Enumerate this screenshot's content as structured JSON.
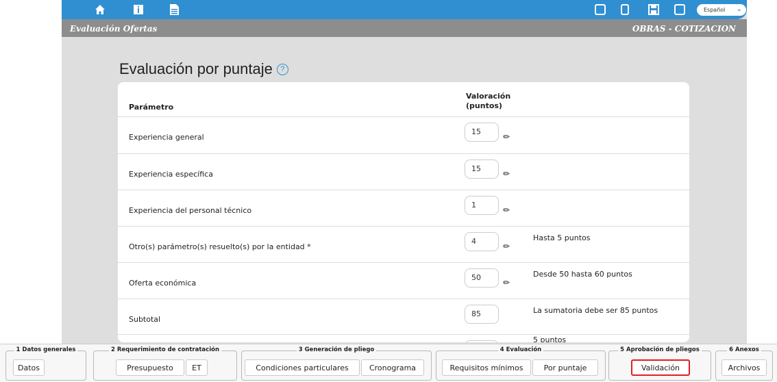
{
  "header": {
    "language": "Español",
    "section_left": "Evaluación Ofertas",
    "section_right": "OBRAS - COTIZACION"
  },
  "main": {
    "title": "Evaluación por puntaje",
    "help": "?",
    "col_param": "Parámetro",
    "col_val_1": "Valoración",
    "col_val_2": "(puntos)",
    "rows": [
      {
        "name": "Experiencia general",
        "value": "15",
        "note": ""
      },
      {
        "name": "Experiencia específica",
        "value": "15",
        "note": ""
      },
      {
        "name": "Experiencia del personal técnico",
        "value": "1",
        "note": ""
      },
      {
        "name": "Otro(s) parámetro(s) resuelto(s) por la entidad *",
        "value": "4",
        "note": "Hasta 5 puntos"
      },
      {
        "name": "Oferta económica",
        "value": "50",
        "note": "Desde 50 hasta 60 puntos"
      },
      {
        "name": "Subtotal",
        "value": "85",
        "note": "La sumatoria debe ser 85 puntos"
      },
      {
        "name": "",
        "value": "",
        "note": "5 puntos"
      }
    ]
  },
  "footer": {
    "groups": [
      {
        "label": "1 Datos generales",
        "buttons": [
          "Datos"
        ]
      },
      {
        "label": "2 Requerimiento de contratación",
        "buttons": [
          "Presupuesto",
          "ET"
        ]
      },
      {
        "label": "3 Generación de pliego",
        "buttons": [
          "Condiciones particulares",
          "Cronograma"
        ]
      },
      {
        "label": "4 Evaluación",
        "buttons": [
          "Requisitos mínimos",
          "Por puntaje"
        ]
      },
      {
        "label": "5 Aprobación de pliegos",
        "buttons": [
          "Validación"
        ]
      },
      {
        "label": "6 Anexos",
        "buttons": [
          "Archivos"
        ]
      }
    ]
  }
}
